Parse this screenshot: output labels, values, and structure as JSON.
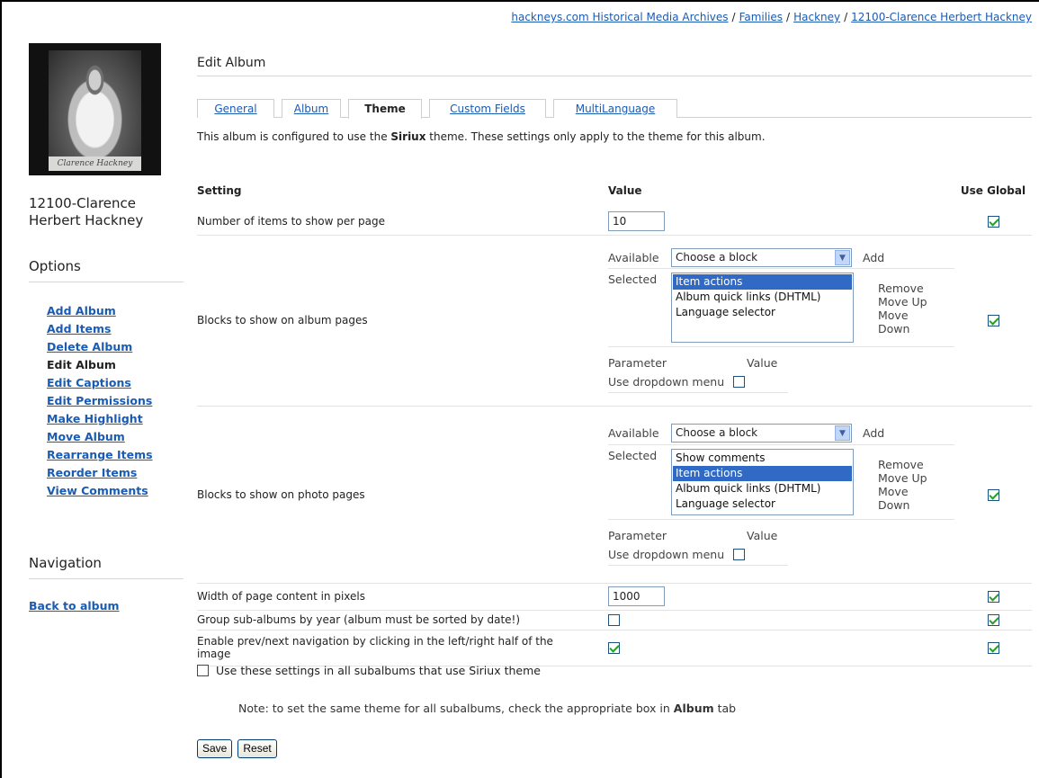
{
  "breadcrumb": {
    "items": [
      "hackneys.com Historical Media Archives",
      "Families",
      "Hackney",
      "12100-Clarence Herbert Hackney"
    ],
    "separator": "/"
  },
  "sidebar": {
    "thumb_signature": "Clarence Hackney",
    "album_name": "12100-Clarence Herbert Hackney",
    "options_heading": "Options",
    "options": [
      {
        "label": "Add Album",
        "current": false
      },
      {
        "label": "Add Items",
        "current": false
      },
      {
        "label": "Delete Album",
        "current": false
      },
      {
        "label": "Edit Album",
        "current": true
      },
      {
        "label": "Edit Captions",
        "current": false
      },
      {
        "label": "Edit Permissions",
        "current": false
      },
      {
        "label": "Make Highlight",
        "current": false
      },
      {
        "label": "Move Album",
        "current": false
      },
      {
        "label": "Rearrange Items",
        "current": false
      },
      {
        "label": "Reorder Items",
        "current": false
      },
      {
        "label": "View Comments",
        "current": false
      }
    ],
    "navigation_heading": "Navigation",
    "back_link": "Back to album"
  },
  "main": {
    "title": "Edit Album",
    "tabs": [
      {
        "label": "General",
        "active": false
      },
      {
        "label": "Album",
        "active": false
      },
      {
        "label": "Theme",
        "active": true
      },
      {
        "label": "Custom Fields",
        "active": false
      },
      {
        "label": "MultiLanguage",
        "active": false
      }
    ],
    "intro": {
      "prefix": "This album is configured to use the ",
      "theme": "Siriux",
      "suffix": " theme. These settings only apply to the theme for this album."
    },
    "headers": {
      "setting": "Setting",
      "value": "Value",
      "use_global": "Use Global"
    },
    "items_per_page": {
      "label": "Number of items to show per page",
      "value": "10",
      "use_global": true
    },
    "album_blocks": {
      "label": "Blocks to show on album pages",
      "available_label": "Available",
      "choose_placeholder": "Choose a block",
      "add_label": "Add",
      "selected_label": "Selected",
      "selected_items": [
        {
          "label": "Item actions",
          "highlighted": true
        },
        {
          "label": "Album quick links (DHTML)",
          "highlighted": false
        },
        {
          "label": "Language selector",
          "highlighted": false
        }
      ],
      "remove_label": "Remove",
      "move_up_label": "Move Up",
      "move_down_label": "Move Down",
      "parameter_label": "Parameter",
      "value_label": "Value",
      "dropdown_label": "Use dropdown menu",
      "dropdown_checked": false,
      "use_global": true
    },
    "photo_blocks": {
      "label": "Blocks to show on photo pages",
      "available_label": "Available",
      "choose_placeholder": "Choose a block",
      "add_label": "Add",
      "selected_label": "Selected",
      "selected_items": [
        {
          "label": "Show comments",
          "highlighted": false
        },
        {
          "label": "Item actions",
          "highlighted": true
        },
        {
          "label": "Album quick links (DHTML)",
          "highlighted": false
        },
        {
          "label": "Language selector",
          "highlighted": false
        }
      ],
      "remove_label": "Remove",
      "move_up_label": "Move Up",
      "move_down_label": "Move Down",
      "parameter_label": "Parameter",
      "value_label": "Value",
      "dropdown_label": "Use dropdown menu",
      "dropdown_checked": false,
      "use_global": true
    },
    "page_width": {
      "label": "Width of page content in pixels",
      "value": "1000",
      "use_global": true
    },
    "group_by_year": {
      "label": "Group sub-albums by year (album must be sorted by date!)",
      "checked": false,
      "use_global": true
    },
    "prev_next": {
      "label": "Enable prev/next navigation by clicking in the left/right half of the image",
      "checked": true,
      "use_global": true
    },
    "apply_all": {
      "label": "Use these settings in all subalbums that use Siriux theme",
      "checked": false
    },
    "note": {
      "prefix": "Note: to set the same theme for all subalbums, check the appropriate box in ",
      "tab_name": "Album",
      "suffix": " tab"
    },
    "buttons": {
      "save": "Save",
      "reset": "Reset"
    }
  },
  "colors": {
    "link": "#1a5bb3",
    "highlight": "#316ac5",
    "check": "#21a121"
  }
}
